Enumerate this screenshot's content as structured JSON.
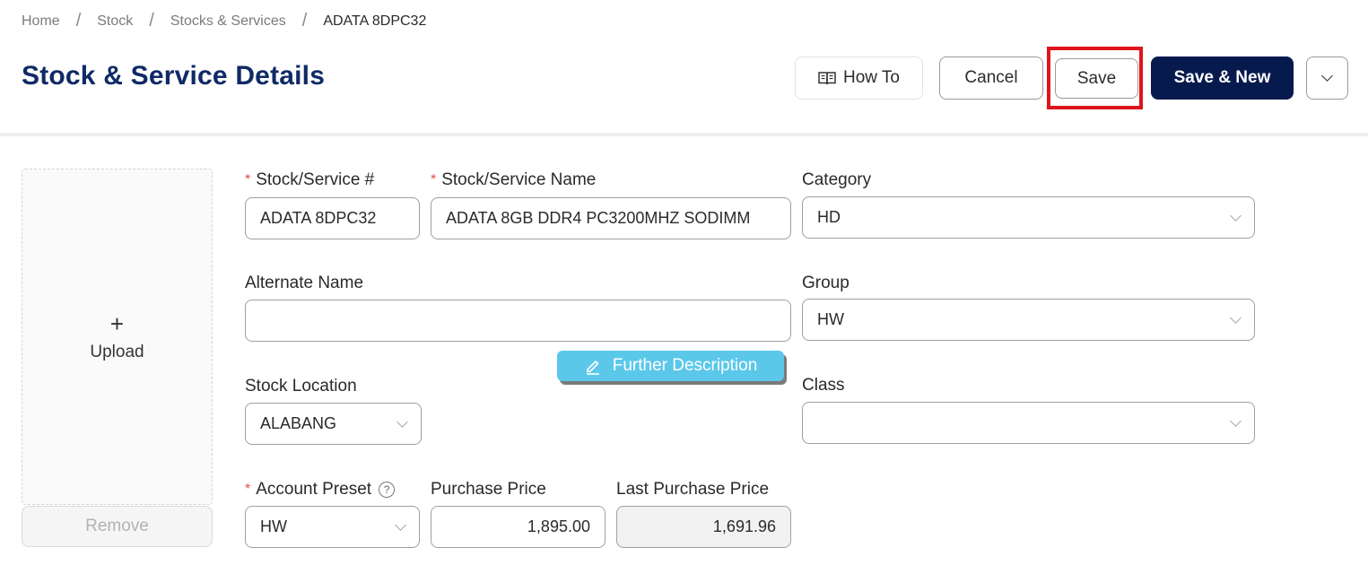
{
  "breadcrumb": {
    "items": [
      "Home",
      "Stock",
      "Stocks & Services"
    ],
    "separator": "/",
    "current": "ADATA 8DPC32"
  },
  "header": {
    "title": "Stock & Service Details",
    "buttons": {
      "how_to": "How To",
      "cancel": "Cancel",
      "save": "Save",
      "save_new": "Save & New"
    }
  },
  "upload": {
    "plus": "+",
    "label": "Upload",
    "remove": "Remove"
  },
  "form": {
    "stock_number": {
      "label": "Stock/Service #",
      "value": "ADATA 8DPC32",
      "required": true
    },
    "stock_name": {
      "label": "Stock/Service Name",
      "value": "ADATA 8GB DDR4 PC3200MHZ SODIMM",
      "required": true
    },
    "category": {
      "label": "Category",
      "value": "HD"
    },
    "alternate_name": {
      "label": "Alternate Name",
      "value": ""
    },
    "group": {
      "label": "Group",
      "value": "HW"
    },
    "further_description": "Further Description",
    "stock_location": {
      "label": "Stock Location",
      "value": "ALABANG"
    },
    "class": {
      "label": "Class",
      "value": ""
    },
    "account_preset": {
      "label": "Account Preset",
      "value": "HW",
      "required": true,
      "help": "?"
    },
    "purchase_price": {
      "label": "Purchase Price",
      "value": "1,895.00"
    },
    "last_purchase_price": {
      "label": "Last Purchase Price",
      "value": "1,691.96"
    }
  },
  "colors": {
    "title": "#0f2a66",
    "primary_button": "#071a4d",
    "further_button": "#5bc8ea",
    "required_mark": "#e84a4a",
    "highlight": "#e0141b"
  },
  "icons": {
    "how_to": "book-icon",
    "further": "pencil-icon",
    "more": "chevron-down-icon"
  }
}
